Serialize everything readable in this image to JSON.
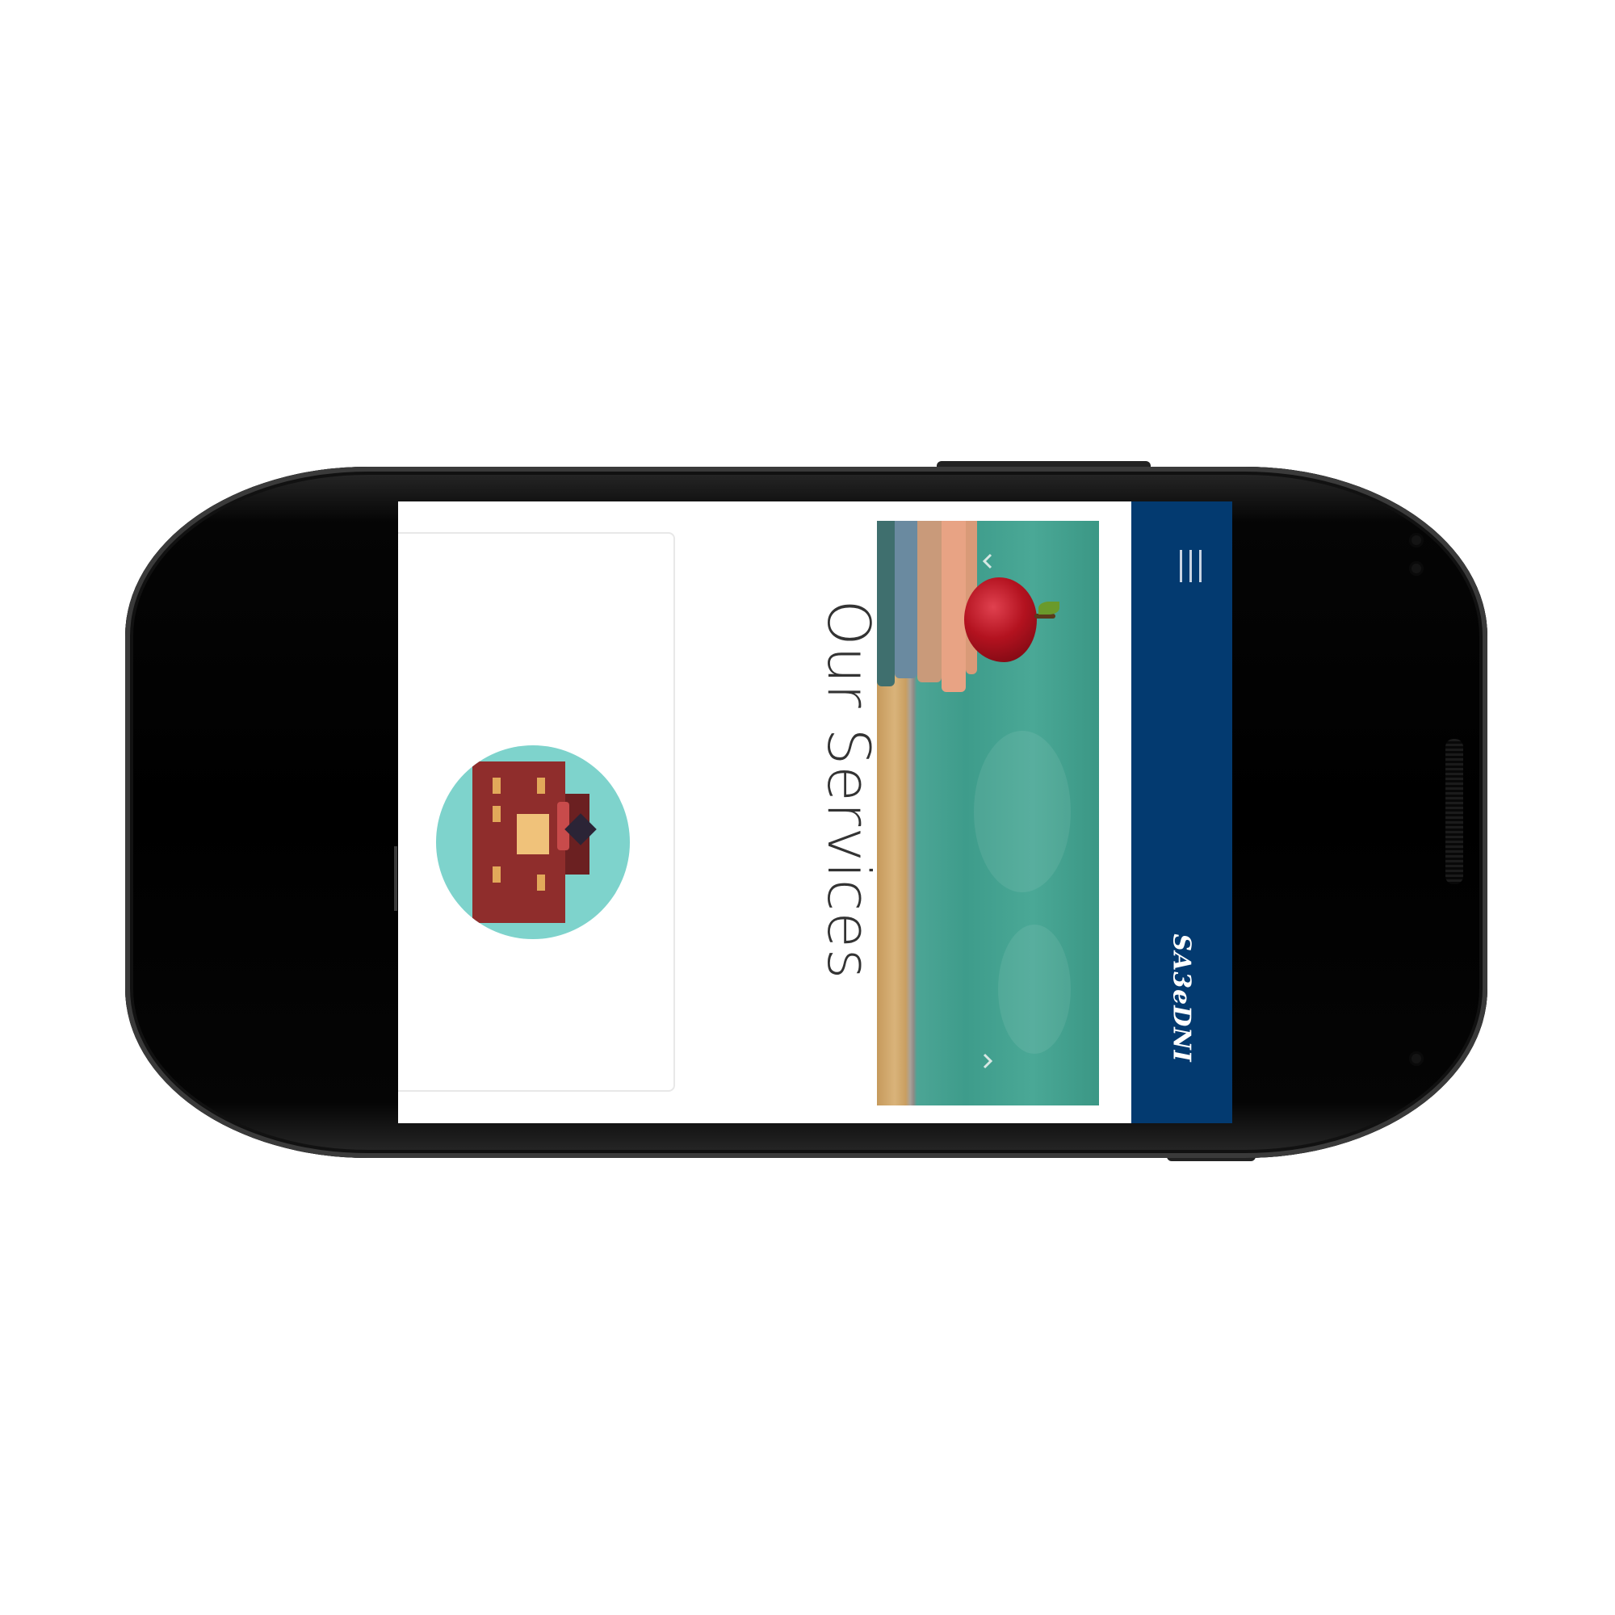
{
  "app": {
    "brand": "SA3eDNI",
    "menu_icon": "hamburger-icon"
  },
  "carousel": {
    "prev_icon": "chevron-up-icon",
    "next_icon": "chevron-down-icon",
    "image": "books-apple-chalkboard"
  },
  "services": {
    "title": "Our Services",
    "card_image": "school-building-illustration"
  },
  "colors": {
    "navbar": "#033a70",
    "chalkboard": "#3e9c8b",
    "card_circle": "#7ed3cc",
    "title_text": "#333333"
  }
}
